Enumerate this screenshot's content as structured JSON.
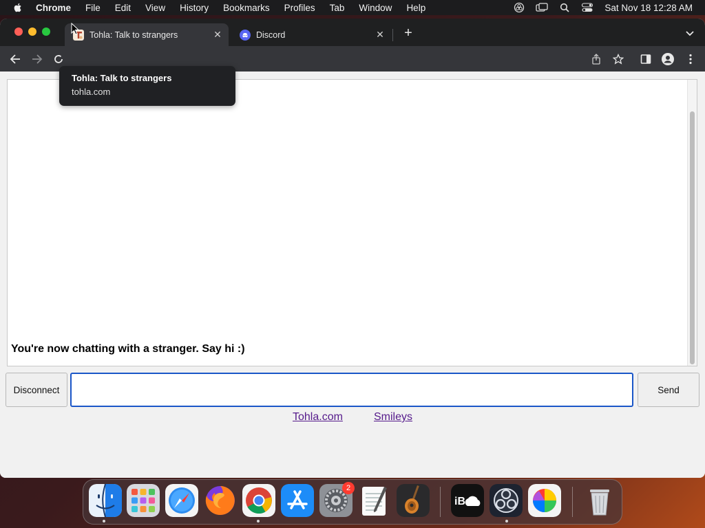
{
  "menubar": {
    "app_name": "Chrome",
    "items": [
      "File",
      "Edit",
      "View",
      "History",
      "Bookmarks",
      "Profiles",
      "Tab",
      "Window",
      "Help"
    ],
    "clock": "Sat Nov 18  12:28 AM"
  },
  "tabs": [
    {
      "title": "Tohla: Talk to strangers",
      "active": true,
      "favicon": "tohla-favicon"
    },
    {
      "title": "Discord",
      "active": false,
      "favicon": "discord-icon"
    }
  ],
  "tooltip": {
    "title": "Tohla: Talk to strangers",
    "url": "tohla.com"
  },
  "chat": {
    "message": "You're now chatting with a stranger. Say hi :)",
    "input_value": "",
    "disconnect_label": "Disconnect",
    "send_label": "Send"
  },
  "footer_links": [
    "Tohla.com",
    "Smileys"
  ],
  "dock": {
    "apps": [
      "Finder",
      "Launchpad",
      "Safari",
      "Firefox",
      "Google Chrome",
      "App Store",
      "System Settings",
      "TextEdit",
      "GarageBand",
      "iBoysoft iCloud",
      "OBS",
      "Color Picker",
      "Trash"
    ],
    "settings_badge": "2"
  },
  "colors": {
    "menubar": "#1c1c1e",
    "tabstrip": "#1f2021",
    "toolbar": "#35363a",
    "input_focus": "#1a56c8",
    "link": "#551a8b"
  }
}
